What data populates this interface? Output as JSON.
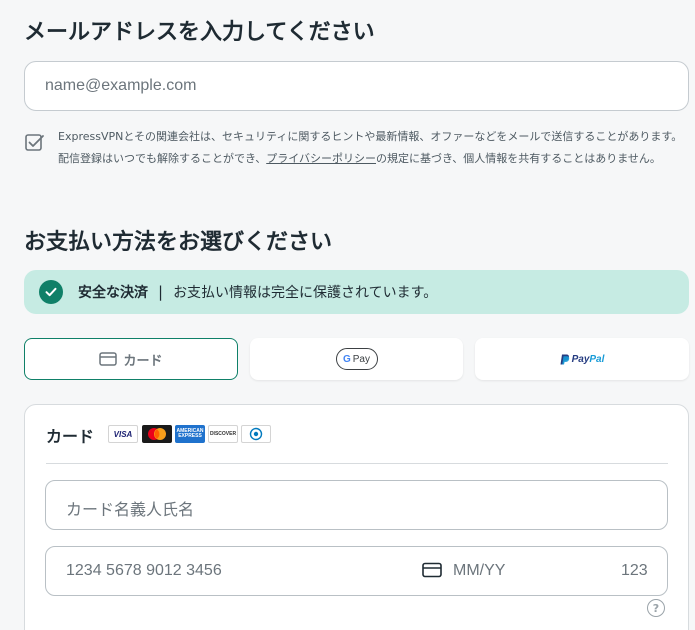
{
  "email_section": {
    "heading": "メールアドレスを入力してください",
    "email_placeholder": "name@example.com",
    "consent_text_1": "ExpressVPNとその関連会社は、セキュリティに関するヒントや最新情報、オファーなどをメールで送信することがあります。配信登録はいつでも解除することができ、",
    "consent_link": "プライバシーポリシー",
    "consent_text_2": "の規定に基づき、個人情報を共有することはありません。",
    "consent_checked": true
  },
  "payment_section": {
    "heading": "お支払い方法をお選びください",
    "secure_banner": {
      "title": "安全な決済",
      "separator": "|",
      "description": "お支払い情報は完全に保護されています。",
      "icon": "check-circle-icon",
      "background": "#c6ebe3",
      "accent": "#0f8068"
    },
    "methods": [
      {
        "id": "card",
        "label": "カード",
        "icon": "credit-card-icon",
        "selected": true
      },
      {
        "id": "gpay",
        "label": "G Pay",
        "icon": "google-pay-logo",
        "selected": false
      },
      {
        "id": "paypal",
        "label": "PayPal",
        "icon": "paypal-logo",
        "selected": false
      }
    ],
    "card_form": {
      "title": "カード",
      "brands": [
        {
          "name": "visa",
          "text": "VISA"
        },
        {
          "name": "mastercard",
          "text": ""
        },
        {
          "name": "amex",
          "text": "AMERICAN EXPRESS"
        },
        {
          "name": "discover",
          "text": "DISCOVER"
        },
        {
          "name": "diners",
          "text": ""
        }
      ],
      "cardholder_placeholder": "カード名義人氏名",
      "number_placeholder": "1234 5678 9012 3456",
      "expiry_placeholder": "MM/YY",
      "cvc_placeholder": "123"
    }
  },
  "colors": {
    "background": "#f6f7f8",
    "text": "#1f2b33",
    "muted": "#6c757c",
    "selected_border": "#0f8068"
  }
}
